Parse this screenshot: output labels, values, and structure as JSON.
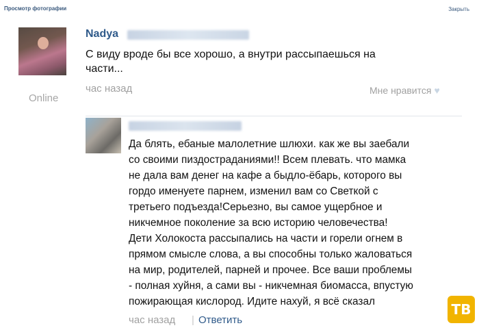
{
  "header": {
    "title": "Просмотр фотографии",
    "close_label": "Закрыть"
  },
  "post": {
    "author": "Nadya",
    "status": "Online",
    "text": "С виду вроде бы все хорошо, а внутри рассыпаешься на части...",
    "text_lines": [
      "С виду вроде бы все хорошо, а внутри рассыпаешься на",
      "части..."
    ],
    "time": "час назад",
    "like_label": "Мне нравится"
  },
  "reply": {
    "lines": [
      "Да блять, ебаные малолетние шлюхи. как же вы заебали",
      "со своими пиздострадaниями!! Всем плевать. что мамка",
      "не дала вам денег на кафе а быдло-ёбарь, которого вы",
      "гордо именуете парнем, изменил вам со Светкой с",
      "третьего подъезда!Серьезно, вы самое ущербное и",
      "никчемное поколение за всю историю человечества!",
      "Дети Холокоста рассыпались на части и горели огнем в",
      "прямом смысле слова, а вы способны только жаловаться",
      "на мир, родителей, парней и прочее. Все ваши проблемы",
      "- полная хуйня, а сами вы - никчемная биомасса, впустую",
      "пожирающая кислород. Идите нахуй, я всё сказал"
    ],
    "time": "час назад",
    "separator": "|",
    "reply_label": "Ответить"
  },
  "badge": {
    "text": "ТВ",
    "color": "#f1b400"
  }
}
